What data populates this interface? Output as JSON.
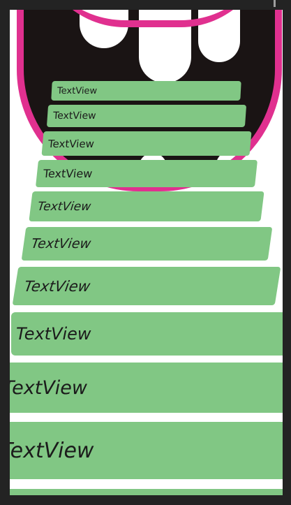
{
  "colors": {
    "background": "#232323",
    "card": "#ffffff",
    "step": "#81c784",
    "monster_outline": "#e0308f",
    "monster_mouth": "#1a1414"
  },
  "steps": [
    {
      "label": "TextView"
    },
    {
      "label": "TextView"
    },
    {
      "label": "TextView"
    },
    {
      "label": "TextView"
    },
    {
      "label": "TextView"
    },
    {
      "label": "TextView"
    },
    {
      "label": "TextView"
    },
    {
      "label": "TextView"
    },
    {
      "label": "TextView"
    },
    {
      "label": "TextView"
    }
  ]
}
